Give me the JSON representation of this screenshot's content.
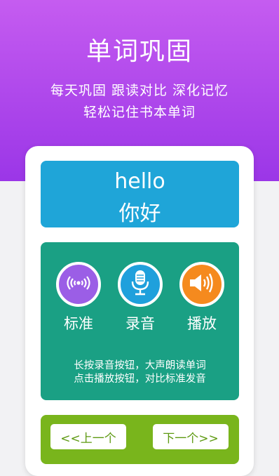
{
  "hero": {
    "title": "单词巩固",
    "subtitle_line1": "每天巩固  跟读对比  深化记忆",
    "subtitle_line2": "轻松记住书本单词"
  },
  "word": {
    "english": "hello",
    "chinese": "你好"
  },
  "practice": {
    "buttons": [
      {
        "label": "标准",
        "icon": "standard-audio-icon"
      },
      {
        "label": "录音",
        "icon": "microphone-icon"
      },
      {
        "label": "播放",
        "icon": "speaker-icon"
      }
    ],
    "hint_line1": "长按录音按钮，大声朗读单词",
    "hint_line2": "点击播放按钮，对比标准发音"
  },
  "nav": {
    "prev_label": "<<上一个",
    "next_label": "下一个>>"
  },
  "colors": {
    "hero_top": "#c55cf0",
    "hero_bottom": "#9b36e7",
    "word_box": "#1fa5d8",
    "practice_box": "#1aa084",
    "nav_box": "#79b51c",
    "standard_button": "#9b5ee6",
    "record_button": "#1fa0dc",
    "play_button": "#f58a1e"
  }
}
